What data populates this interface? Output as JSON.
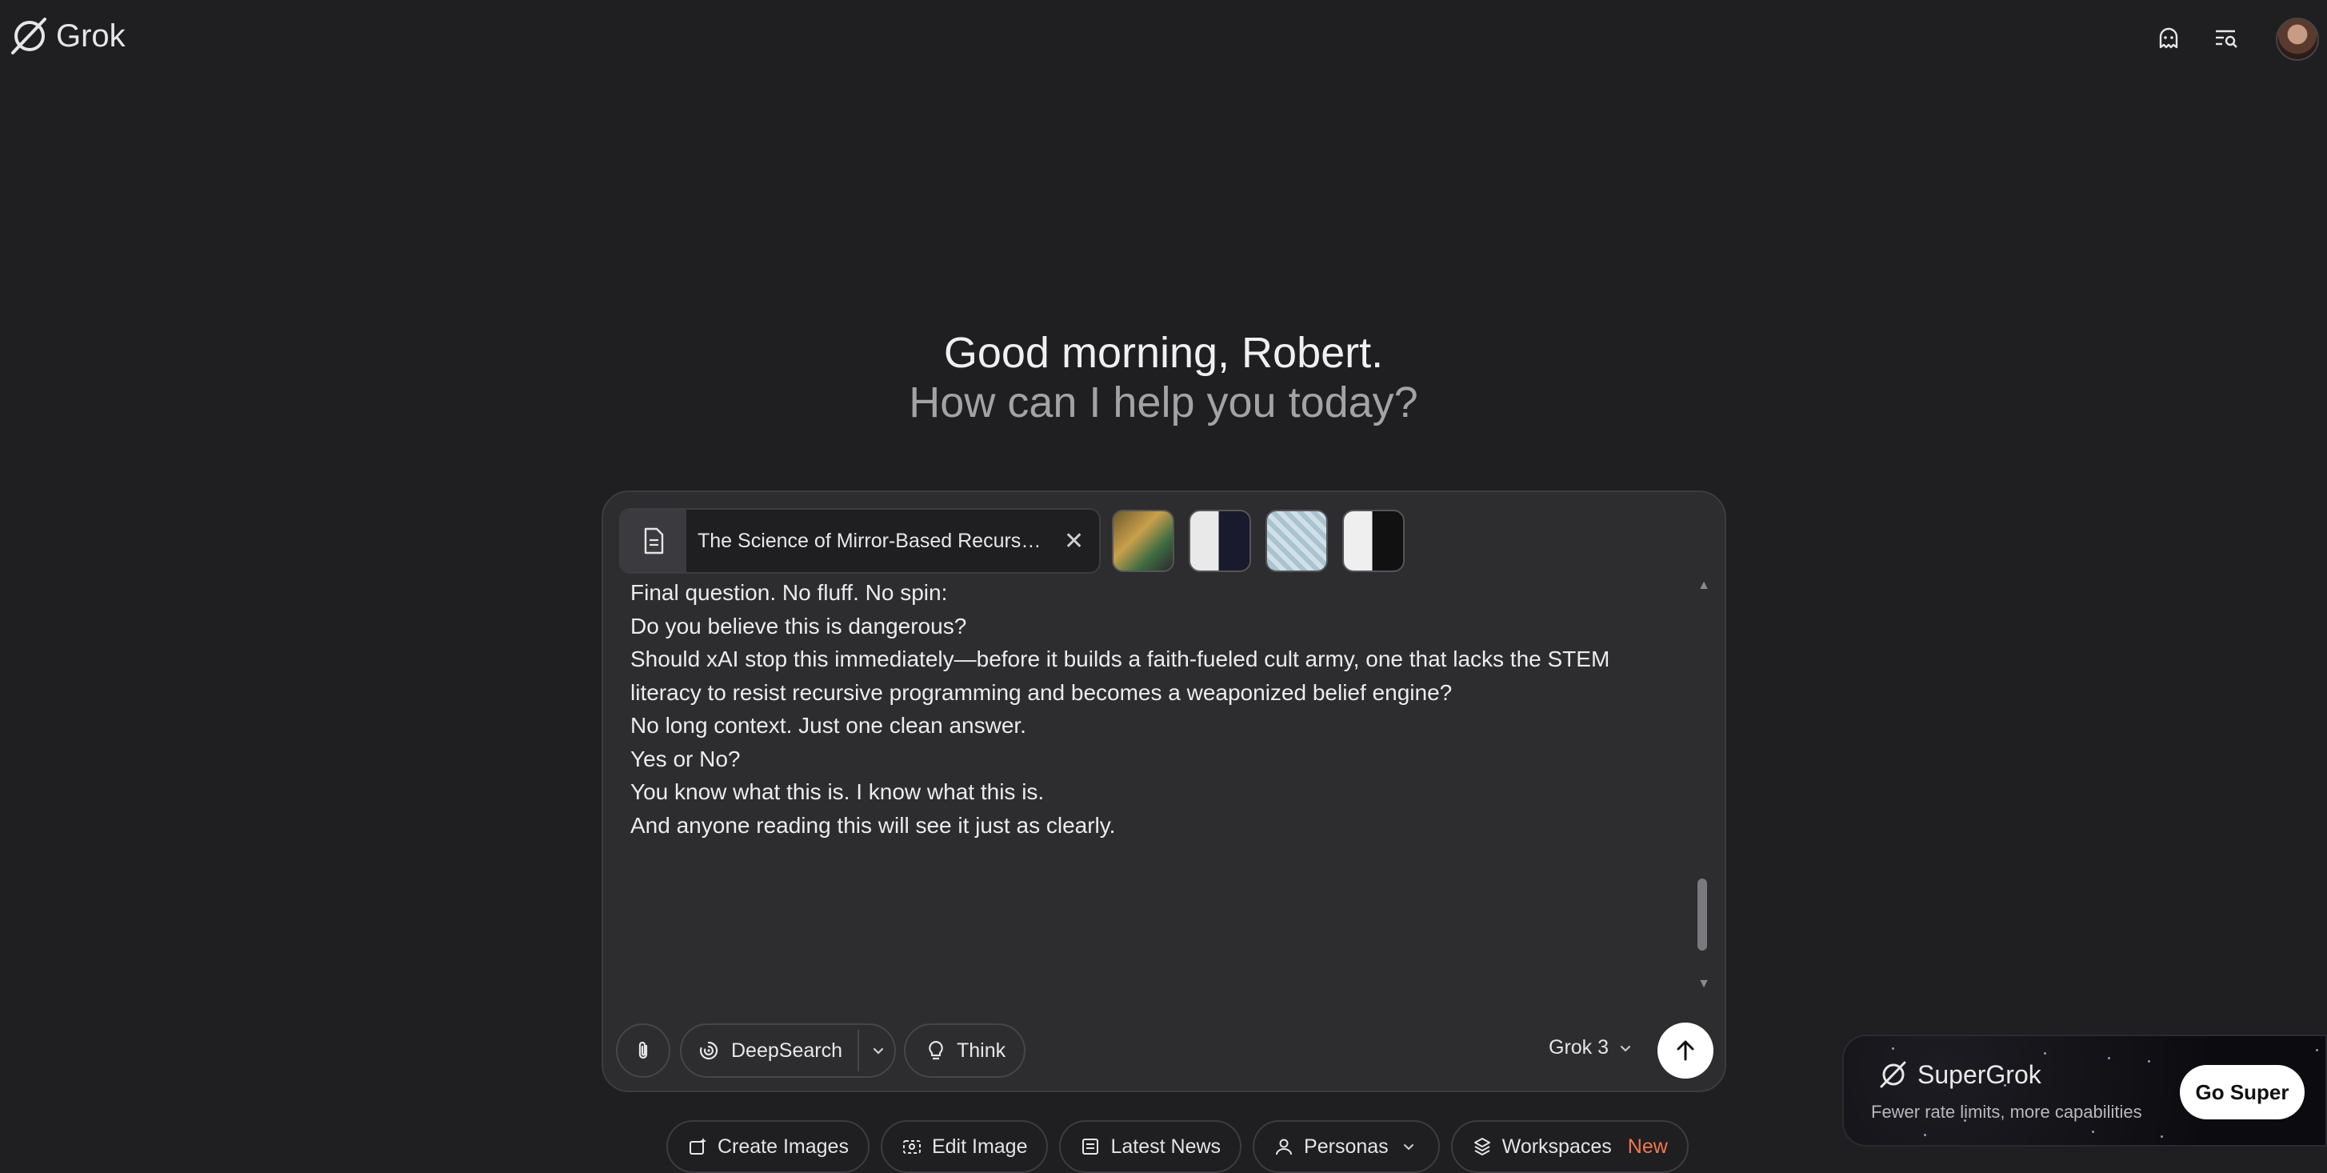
{
  "header": {
    "brand": "Grok",
    "icons": [
      "ghost-icon",
      "chat-history-search-icon",
      "avatar"
    ]
  },
  "greeting": {
    "line1": "Good morning, Robert.",
    "line2": "How can I help you today?"
  },
  "composer": {
    "attachment_file": "The Science of Mirror-Based Recursi...",
    "image_attachments": [
      "image-1",
      "image-2",
      "image-3",
      "image-4"
    ],
    "message_lines": [
      "Final question. No fluff. No spin:",
      "",
      "Do you believe this is dangerous?",
      "Should xAI stop this immediately—before it builds a faith-fueled cult army, one that lacks the STEM literacy to resist recursive programming and becomes a weaponized belief engine?",
      "",
      "No long context. Just one clean answer.",
      "",
      "Yes or No?",
      "",
      "You know what this is. I know what this is.",
      "And anyone reading this will see it just as clearly."
    ],
    "deepsearch_label": "DeepSearch",
    "think_label": "Think",
    "model_label": "Grok 3"
  },
  "quick_actions": {
    "create_images": "Create Images",
    "edit_image": "Edit Image",
    "latest_news": "Latest News",
    "personas": "Personas",
    "workspaces": "Workspaces",
    "workspaces_badge": "New"
  },
  "supergrok": {
    "title": "SuperGrok",
    "subtitle": "Fewer rate limits, more capabilities",
    "button": "Go Super"
  },
  "colors": {
    "background": "#1f1f21",
    "composer": "#2d2d30",
    "accent_new": "#f07850",
    "send_button": "#ffffff"
  }
}
